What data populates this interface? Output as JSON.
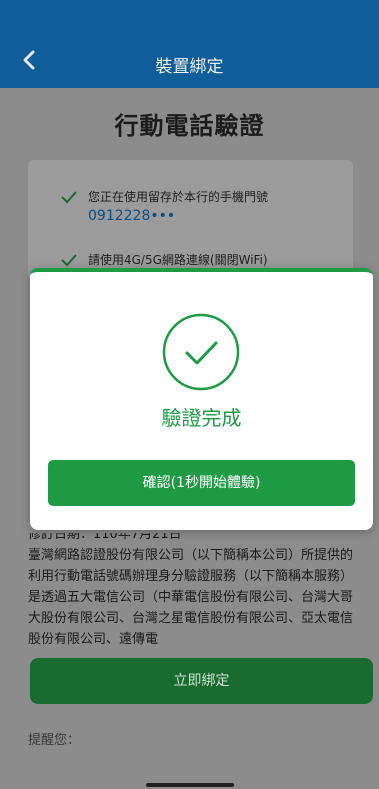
{
  "header": {
    "title": "裝置綁定",
    "back_icon": "chevron-left-icon"
  },
  "page": {
    "title": "行動電話驗證"
  },
  "info": {
    "line1": "您正在使用留存於本行的手機門號",
    "phone": "0912228•••",
    "line2": "請使用4G/5G網路連線(關閉WiFi)"
  },
  "modal": {
    "status_icon": "check-circle-icon",
    "status_text": "驗證完成",
    "confirm_label": "確認(1秒開始體驗)"
  },
  "terms": {
    "revision": "修訂日期：110年7月21日",
    "body": "臺灣網路認證股份有限公司（以下簡稱本公司）所提供的利用行動電話號碼辦理身分驗證服務（以下簡稱本服務）是透過五大電信公司（中華電信股份有限公司、台灣大哥大股份有限公司、台灣之星電信股份有限公司、亞太電信股份有限公司、遠傳電"
  },
  "actions": {
    "bind_label": "立即綁定"
  },
  "footer": {
    "remind": "提醒您："
  },
  "colors": {
    "header": "#0f5d99",
    "accent": "#1f9a45",
    "overlay": "#8c8c8c"
  }
}
